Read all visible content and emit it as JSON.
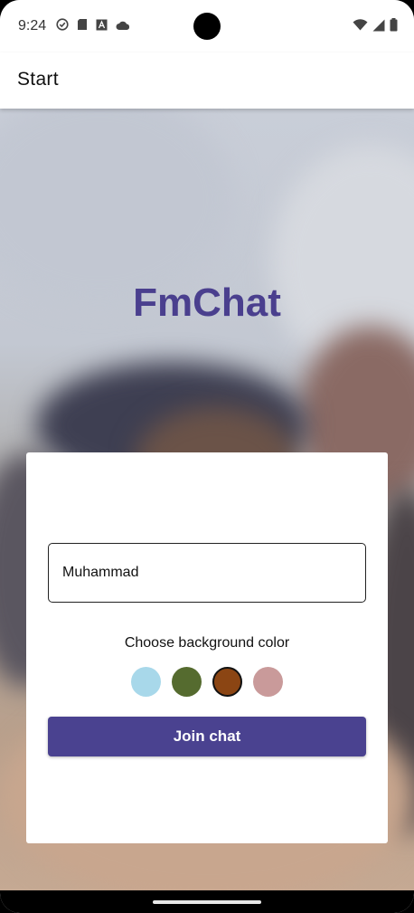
{
  "status_bar": {
    "time": "9:24",
    "left_icons": [
      "check-circle-icon",
      "sd-card-icon",
      "font-icon",
      "cloud-icon"
    ],
    "right_icons": [
      "wifi-icon",
      "signal-icon",
      "battery-icon"
    ]
  },
  "app_bar": {
    "title": "Start"
  },
  "main": {
    "app_name": "FmChat",
    "name_input": {
      "value": "Muhammad",
      "placeholder": ""
    },
    "choose_label": "Choose background color",
    "color_options": [
      {
        "name": "light-blue",
        "color": "#a8d8ea",
        "selected": false
      },
      {
        "name": "olive-green",
        "color": "#556b2f",
        "selected": false
      },
      {
        "name": "brown",
        "color": "#8b4513",
        "selected": true
      },
      {
        "name": "rose",
        "color": "#c99a9a",
        "selected": false
      }
    ],
    "join_button": "Join chat"
  },
  "colors": {
    "brand": "#4a3f8e",
    "button": "#4a4290"
  }
}
